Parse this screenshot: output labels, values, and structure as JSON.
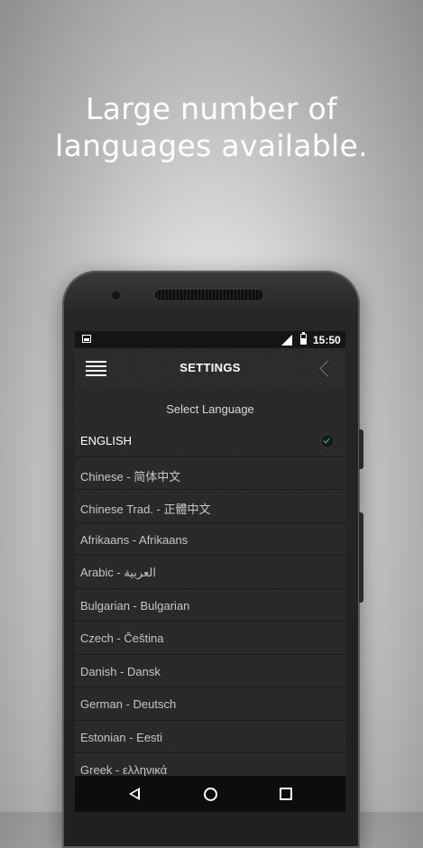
{
  "headline": {
    "line1": "Large number of",
    "line2": "languages available."
  },
  "status_bar": {
    "time": "15:50",
    "icons": [
      "image-notification-icon",
      "signal-icon",
      "battery-icon"
    ]
  },
  "app_bar": {
    "title": "SETTINGS",
    "menu_icon": "hamburger-menu-icon",
    "back_icon": "chevron-left-icon"
  },
  "settings": {
    "select_label": "Select Language",
    "languages": [
      {
        "label": "ENGLISH",
        "selected": true
      },
      {
        "label": "Chinese - 简体中文",
        "selected": false
      },
      {
        "label": "Chinese Trad. - 正體中文",
        "selected": false
      },
      {
        "label": "Afrikaans - Afrikaans",
        "selected": false
      },
      {
        "label": "Arabic - العربية",
        "selected": false
      },
      {
        "label": "Bulgarian - Bulgarian",
        "selected": false
      },
      {
        "label": "Czech - Čeština",
        "selected": false
      },
      {
        "label": "Danish - Dansk",
        "selected": false
      },
      {
        "label": "German - Deutsch",
        "selected": false
      },
      {
        "label": "Estonian - Eesti",
        "selected": false
      },
      {
        "label": "Greek - ελληνικά",
        "selected": false
      }
    ],
    "selected_check_color": "#2ec7a4"
  },
  "nav_bar": {
    "icons": [
      "nav-back-icon",
      "nav-home-icon",
      "nav-recents-icon"
    ]
  }
}
